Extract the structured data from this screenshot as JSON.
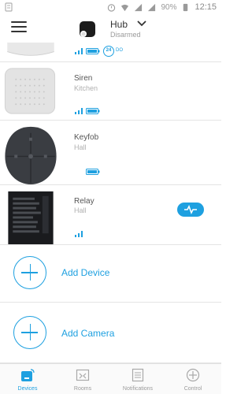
{
  "status_bar": {
    "battery": "90%",
    "time": "12:15"
  },
  "header": {
    "hub_name": "Hub",
    "hub_status": "Disarmed"
  },
  "devices": [
    {
      "name": "",
      "room": "",
      "temperature": "24",
      "temperature_unit": "DO"
    },
    {
      "name": "Siren",
      "room": "Kitchen"
    },
    {
      "name": "Keyfob",
      "room": "Hall"
    },
    {
      "name": "Relay",
      "room": "Hall"
    }
  ],
  "actions": {
    "add_device": "Add Device",
    "add_camera": "Add Camera"
  },
  "nav": [
    {
      "label": "Devices",
      "icon": "devices-icon",
      "active": true
    },
    {
      "label": "Rooms",
      "icon": "rooms-icon",
      "active": false
    },
    {
      "label": "Notifications",
      "icon": "notifications-icon",
      "active": false
    },
    {
      "label": "Control",
      "icon": "control-icon",
      "active": false
    }
  ],
  "colors": {
    "accent": "#1ea0e0"
  }
}
